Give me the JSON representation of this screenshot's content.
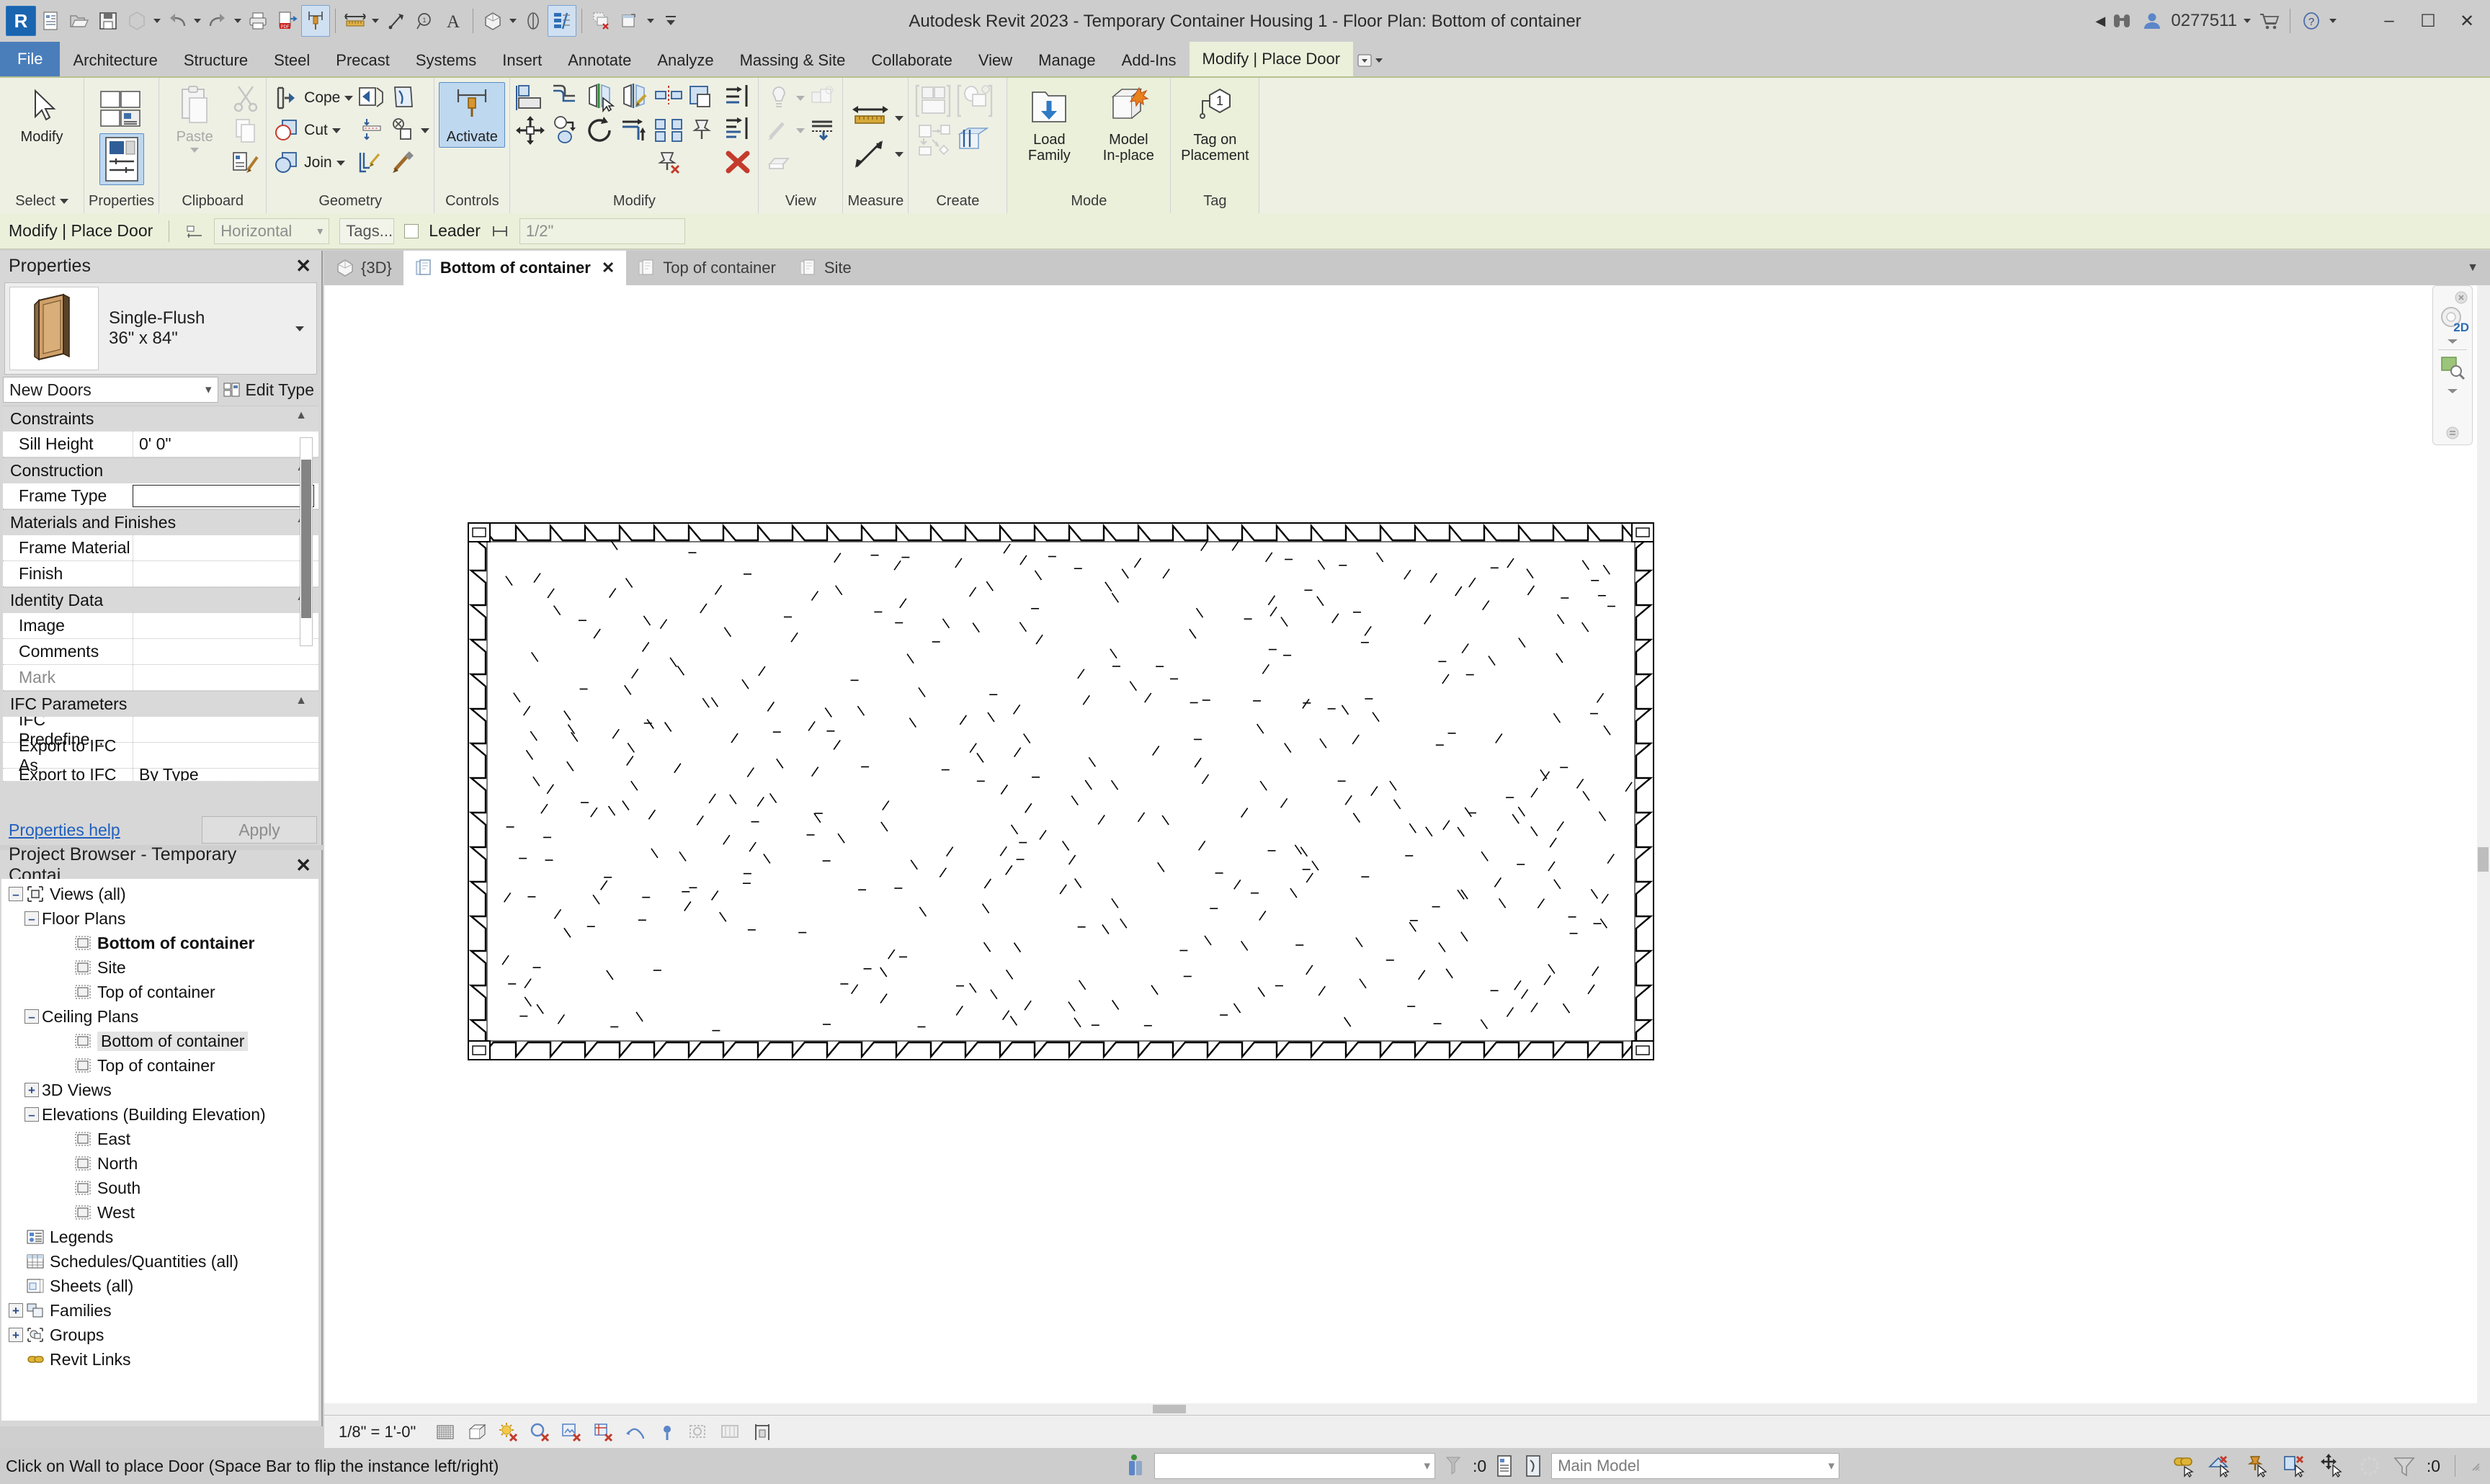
{
  "titlebar": {
    "app_title": "Autodesk Revit 2023 - Temporary Container Housing 1 - Floor Plan: Bottom of container",
    "user_id": "0277511",
    "quick_access": [
      {
        "name": "revit-logo",
        "label": "R"
      },
      {
        "name": "new-project-icon",
        "label": ""
      },
      {
        "name": "open-icon",
        "label": ""
      },
      {
        "name": "save-icon",
        "label": ""
      },
      {
        "name": "save-as-icon",
        "label": ""
      },
      {
        "name": "undo-icon",
        "label": ""
      },
      {
        "name": "redo-icon",
        "label": ""
      },
      {
        "name": "print-icon",
        "label": ""
      },
      {
        "name": "export-pdf-icon",
        "label": ""
      },
      {
        "name": "measure-pin-icon",
        "label": ""
      },
      {
        "name": "aligned-dimension-icon",
        "label": ""
      },
      {
        "name": "tag-by-category-icon",
        "label": ""
      },
      {
        "name": "text-note-icon",
        "label": ""
      },
      {
        "name": "default-3d-view-icon",
        "label": ""
      },
      {
        "name": "section-icon",
        "label": ""
      },
      {
        "name": "thin-lines-icon",
        "label": ""
      },
      {
        "name": "close-hidden-windows-icon",
        "label": ""
      },
      {
        "name": "switch-windows-icon",
        "label": ""
      }
    ],
    "window_buttons": {
      "minimize": "–",
      "maximize": "☐",
      "close": "✕"
    }
  },
  "ribbon_tabs": [
    {
      "label": "File",
      "kind": "file"
    },
    {
      "label": "Architecture",
      "kind": "normal"
    },
    {
      "label": "Structure",
      "kind": "normal"
    },
    {
      "label": "Steel",
      "kind": "normal"
    },
    {
      "label": "Precast",
      "kind": "normal"
    },
    {
      "label": "Systems",
      "kind": "normal"
    },
    {
      "label": "Insert",
      "kind": "normal"
    },
    {
      "label": "Annotate",
      "kind": "normal"
    },
    {
      "label": "Analyze",
      "kind": "normal"
    },
    {
      "label": "Massing & Site",
      "kind": "normal"
    },
    {
      "label": "Collaborate",
      "kind": "normal"
    },
    {
      "label": "View",
      "kind": "normal"
    },
    {
      "label": "Manage",
      "kind": "normal"
    },
    {
      "label": "Add-Ins",
      "kind": "normal"
    },
    {
      "label": "Modify | Place Door",
      "kind": "context"
    }
  ],
  "ribbon": {
    "panels": [
      {
        "title": "Select",
        "has_caret": true
      },
      {
        "title": "Properties",
        "has_caret": false
      },
      {
        "title": "Clipboard",
        "has_caret": false
      },
      {
        "title": "Geometry",
        "has_caret": false
      },
      {
        "title": "Controls",
        "has_caret": false
      },
      {
        "title": "Modify",
        "has_caret": false
      },
      {
        "title": "View",
        "has_caret": false
      },
      {
        "title": "Measure",
        "has_caret": false
      },
      {
        "title": "Create",
        "has_caret": false
      },
      {
        "title": "Mode",
        "has_caret": false
      },
      {
        "title": "Tag",
        "has_caret": false
      }
    ],
    "select": {
      "modify_label": "Modify"
    },
    "properties": {
      "properties_label": "",
      "type_properties_icon": "type-properties-icon"
    },
    "clipboard": {
      "paste_label": "Paste",
      "cut_icon": "cut-icon",
      "copy_icon": "copy-icon",
      "match_type_icon": "match-type-properties-icon"
    },
    "geometry": {
      "cope_label": "Cope",
      "cut_label": "Cut",
      "join_label": "Join",
      "demolish_icon": "demolish-icon",
      "split_face_icon": "split-face-icon",
      "paint_icon": "paint-icon",
      "wall_joins_icon": "wall-joins-icon"
    },
    "controls": {
      "activate_label": "Activate"
    },
    "modify": {
      "align_icon": "align-icon",
      "offset_icon": "offset-icon",
      "mirror_pick_axis_icon": "mirror-pick-axis-icon",
      "mirror_draw_axis_icon": "mirror-draw-axis-icon",
      "move_icon": "move-icon",
      "copy_icon": "copy-icon",
      "rotate_icon": "rotate-icon",
      "trim_extend_icon": "trim-extend-icon",
      "split_icon": "split-element-icon",
      "array_icon": "array-icon",
      "scale_icon": "scale-icon",
      "unpin_icon": "unpin-icon",
      "pin_icon": "pin-icon",
      "delete_icon": "delete-icon"
    },
    "view": {
      "hide_icon": "hide-element-icon",
      "temporary_hide_icon": "temporary-hide-isolate-icon",
      "linework_icon": "linework-icon",
      "reveal_icon": "reveal-hidden-icon",
      "render_icon": "render-in-cloud-icon"
    },
    "measure": {
      "measure_between_icon": "measure-between-two-references-icon",
      "measure_along_icon": "measure-along-an-element-icon"
    },
    "create": {
      "create_similar_icon": "create-similar-icon",
      "create_group_icon": "create-group-icon",
      "create_part_icon": "create-parts-icon",
      "create_assembly_icon": "create-assembly-icon"
    },
    "mode": {
      "load_family_label": "Load\nFamily",
      "load_family_line1": "Load",
      "load_family_line2": "Family",
      "model_inplace_line1": "Model",
      "model_inplace_line2": "In-place"
    },
    "tag": {
      "tag_on_placement_line1": "Tag on",
      "tag_on_placement_line2": "Placement",
      "badge": "1"
    }
  },
  "options_bar": {
    "context_label": "Modify | Place Door",
    "orientation_value": "Horizontal",
    "tags_button": "Tags...",
    "leader_label": "Leader",
    "leader_checked": false,
    "leader_length": "1/2\""
  },
  "properties_panel": {
    "title": "Properties",
    "close": "✕",
    "type_name_line1": "Single-Flush",
    "type_name_line2": "36\" x 84\"",
    "instance_selector": "New Doors",
    "edit_type": "Edit Type",
    "footer_link": "Properties help",
    "apply_button": "Apply",
    "groups": [
      {
        "name": "Constraints",
        "rows": [
          {
            "name": "Sill Height",
            "value": "0'  0\"",
            "dim": false,
            "boxed": false
          }
        ]
      },
      {
        "name": "Construction",
        "rows": [
          {
            "name": "Frame Type",
            "value": "",
            "dim": false,
            "boxed": true
          }
        ]
      },
      {
        "name": "Materials and Finishes",
        "rows": [
          {
            "name": "Frame Material",
            "value": "",
            "dim": false,
            "boxed": false
          },
          {
            "name": "Finish",
            "value": "",
            "dim": false,
            "boxed": false
          }
        ]
      },
      {
        "name": "Identity Data",
        "rows": [
          {
            "name": "Image",
            "value": "",
            "dim": false,
            "boxed": false
          },
          {
            "name": "Comments",
            "value": "",
            "dim": false,
            "boxed": false
          },
          {
            "name": "Mark",
            "value": "",
            "dim": true,
            "boxed": false
          }
        ]
      },
      {
        "name": "IFC Parameters",
        "rows": [
          {
            "name": "IFC Predefine...",
            "value": "",
            "dim": false,
            "boxed": false
          },
          {
            "name": "Export to IFC As",
            "value": "",
            "dim": false,
            "boxed": false
          },
          {
            "name": "Export to IFC",
            "value": "By Type",
            "dim": false,
            "boxed": false
          }
        ]
      }
    ]
  },
  "project_browser": {
    "title": "Project Browser - Temporary Contai...",
    "close": "✕",
    "nodes": [
      {
        "label": "Views (all)",
        "indent": 0,
        "toggle": "minus",
        "icon": "views-all-icon",
        "style": "normal"
      },
      {
        "label": "Floor Plans",
        "indent": 1,
        "toggle": "minus",
        "icon": "none",
        "style": "normal"
      },
      {
        "label": "Bottom of container",
        "indent": 3,
        "toggle": "none",
        "icon": "view-icon",
        "style": "bold"
      },
      {
        "label": "Site",
        "indent": 3,
        "toggle": "none",
        "icon": "view-icon",
        "style": "normal"
      },
      {
        "label": "Top of container",
        "indent": 3,
        "toggle": "none",
        "icon": "view-icon",
        "style": "normal"
      },
      {
        "label": "Ceiling Plans",
        "indent": 1,
        "toggle": "minus",
        "icon": "none",
        "style": "normal"
      },
      {
        "label": "Bottom of container",
        "indent": 3,
        "toggle": "none",
        "icon": "view-icon",
        "style": "selected"
      },
      {
        "label": "Top of container",
        "indent": 3,
        "toggle": "none",
        "icon": "view-icon",
        "style": "normal"
      },
      {
        "label": "3D Views",
        "indent": 1,
        "toggle": "plus",
        "icon": "none",
        "style": "normal"
      },
      {
        "label": "Elevations (Building Elevation)",
        "indent": 1,
        "toggle": "minus",
        "icon": "none",
        "style": "normal"
      },
      {
        "label": "East",
        "indent": 3,
        "toggle": "none",
        "icon": "view-icon",
        "style": "normal"
      },
      {
        "label": "North",
        "indent": 3,
        "toggle": "none",
        "icon": "view-icon",
        "style": "normal"
      },
      {
        "label": "South",
        "indent": 3,
        "toggle": "none",
        "icon": "view-icon",
        "style": "normal"
      },
      {
        "label": "West",
        "indent": 3,
        "toggle": "none",
        "icon": "view-icon",
        "style": "normal"
      },
      {
        "label": "Legends",
        "indent": 0,
        "toggle": "none",
        "icon": "legend-icon",
        "style": "normal"
      },
      {
        "label": "Schedules/Quantities (all)",
        "indent": 0,
        "toggle": "none",
        "icon": "schedule-icon",
        "style": "normal"
      },
      {
        "label": "Sheets (all)",
        "indent": 0,
        "toggle": "none",
        "icon": "sheet-icon",
        "style": "normal"
      },
      {
        "label": "Families",
        "indent": 0,
        "toggle": "plus",
        "icon": "families-icon",
        "style": "normal"
      },
      {
        "label": "Groups",
        "indent": 0,
        "toggle": "plus",
        "icon": "groups-icon",
        "style": "normal"
      },
      {
        "label": "Revit Links",
        "indent": 0,
        "toggle": "none",
        "icon": "revit-links-icon",
        "style": "normal"
      }
    ]
  },
  "view_tabs": [
    {
      "label": "{3D}",
      "active": false,
      "closable": false,
      "icon": "view-3d-icon"
    },
    {
      "label": "Bottom of container",
      "active": true,
      "closable": true,
      "icon": "floor-plan-icon"
    },
    {
      "label": "Top of container",
      "active": false,
      "closable": false,
      "icon": "floor-plan-icon"
    },
    {
      "label": "Site",
      "active": false,
      "closable": false,
      "icon": "floor-plan-icon"
    }
  ],
  "navigation": {
    "view_cube_label": "2D",
    "zoom_icon": "zoom-region-icon"
  },
  "view_control_bar": {
    "scale": "1/8\" = 1'-0\"",
    "icons": [
      "detail-level-icon",
      "visual-style-icon",
      "sun-path-off-icon",
      "shadows-off-icon",
      "rendering-dialog-icon",
      "crop-view-icon",
      "show-crop-region-icon",
      "lock-3d-view-icon",
      "temporary-hide-isolate-icon",
      "reveal-hidden-elements-icon",
      "analytical-model-icon"
    ]
  },
  "status_bar": {
    "message": "Click on Wall to place Door (Space Bar to flip the instance left/right)",
    "editable_only_value": "",
    "filter_count": ":0",
    "worksets_value": "Main Model",
    "selection_count": ":0",
    "right_icons": [
      "link-selection-icon",
      "select-underlay-icon",
      "select-pinned-icon",
      "select-elements-by-face-icon",
      "drag-elements-on-selection-icon",
      "selection-ring-icon",
      "filter-icon"
    ]
  },
  "canvas": {
    "drawing_name": "shipping-container-floor-plan",
    "description": "Rectangular corrugated shipping container outline with hatch pattern fill and corner castings"
  }
}
